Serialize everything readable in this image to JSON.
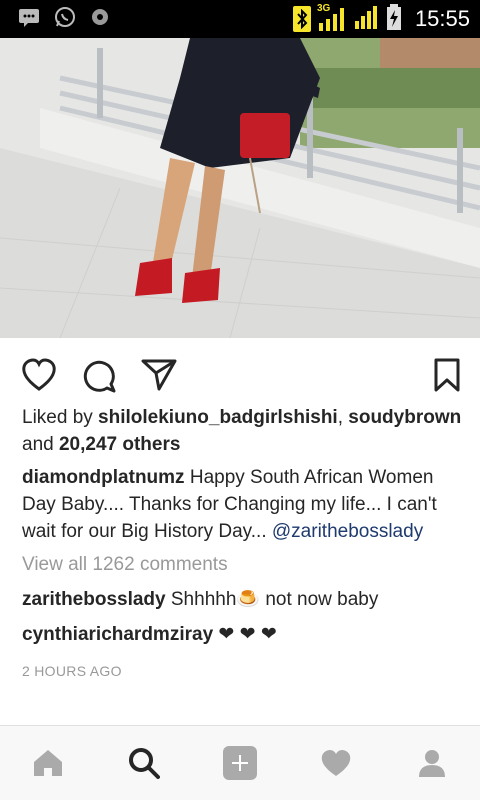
{
  "status_bar": {
    "network": "3G",
    "time": "15:55",
    "icons": [
      "message-icon",
      "whatsapp-icon",
      "sync-icon",
      "bluetooth-icon",
      "signal-icon",
      "battery-icon"
    ]
  },
  "post": {
    "likes": {
      "prefix": "Liked by ",
      "user1": "shilolekiuno_badgirlshishi",
      "sep": ",",
      "user2": "soudybrown",
      "and": " and ",
      "others": "20,247 others"
    },
    "caption": {
      "username": "diamondplatnumz",
      "text": " Happy South African Women Day Baby.... Thanks for Changing my life... I can't wait for our Big History Day...",
      "mention": "@zarithebosslady"
    },
    "view_all": "View all 1262 comments",
    "comments": [
      {
        "username": "zarithebosslady",
        "text": " Shhhhh🍮 not now baby"
      },
      {
        "username": "cynthiarichardmziray",
        "text": " ❤ ❤ ❤"
      }
    ],
    "time_ago": "2 HOURS AGO"
  },
  "colors": {
    "mention": "#1e3a6e",
    "muted": "#999999",
    "text": "#262626"
  }
}
